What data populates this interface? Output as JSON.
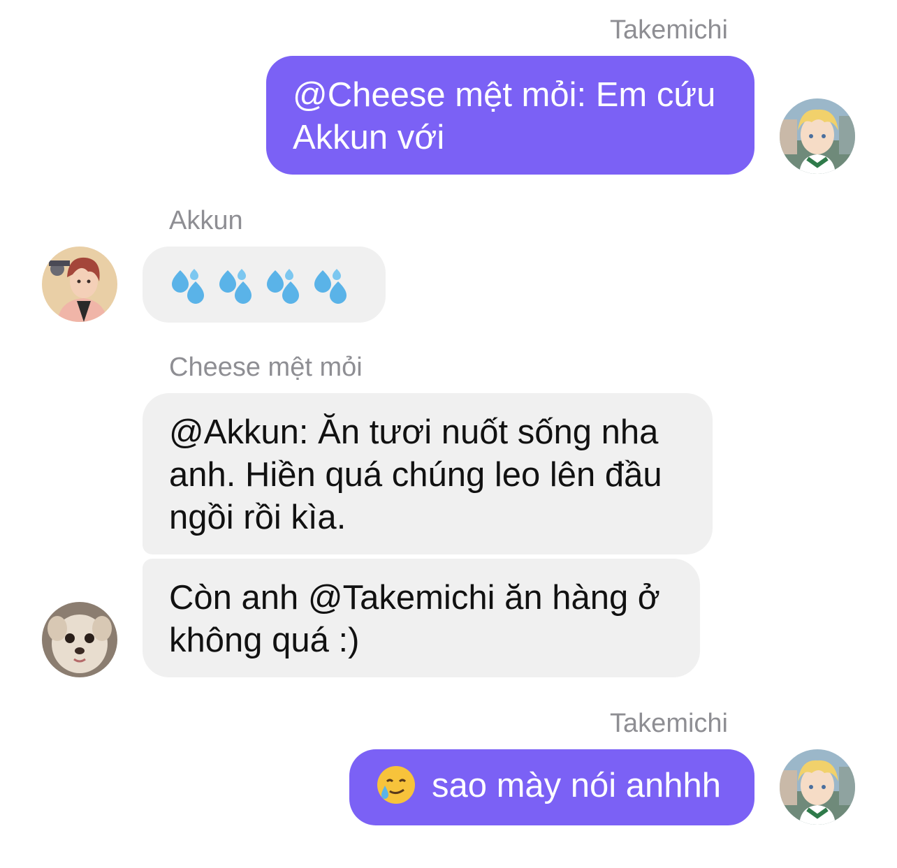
{
  "messages": [
    {
      "sender": "Takemichi",
      "text": "@Cheese mệt mỏi: Em cứu Akkun với",
      "direction": "outgoing"
    },
    {
      "sender": "Akkun",
      "text": "💦💦💦💦",
      "direction": "incoming"
    },
    {
      "sender": "Cheese mệt mỏi",
      "text_1": "@Akkun: Ăn tươi nuốt sống nha anh. Hiền quá chúng leo lên đầu ngồi rồi kìa.",
      "text_2": "Còn anh @Takemichi ăn hàng ở không quá :)",
      "direction": "incoming"
    },
    {
      "sender": "Takemichi",
      "emoji": "🥲",
      "text": "sao mày nói anhhh",
      "direction": "outgoing"
    }
  ],
  "icons": {
    "drop": "sweat-droplets-icon",
    "face": "smiling-face-with-tear-icon"
  },
  "colors": {
    "outgoing_bubble": "#7b61f5",
    "incoming_bubble": "#f0f0f0",
    "sender_label": "#8e8e93"
  }
}
